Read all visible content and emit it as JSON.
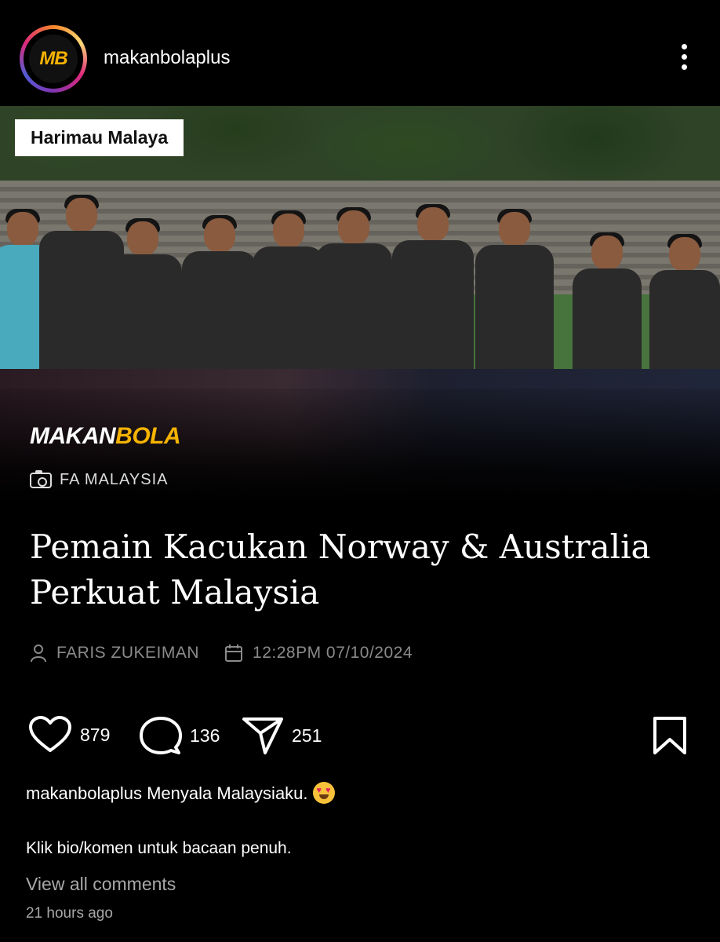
{
  "header": {
    "username": "makanbolaplus",
    "avatar_text": "MB"
  },
  "post_image": {
    "category_tag": "Harimau Malaya",
    "brand_part1": "MAKAN",
    "brand_part2": "BOLA",
    "photo_credit": "FA MALAYSIA",
    "headline": "Pemain Kacukan Norway & Australia Perkuat Malaysia",
    "author": "FARIS ZUKEIMAN",
    "datetime": "12:28PM 07/10/2024",
    "brand_colors": {
      "accent": "#f5b301"
    }
  },
  "actions": {
    "likes": "879",
    "comments": "136",
    "shares": "251"
  },
  "caption": {
    "username": "makanbolaplus",
    "text": "Menyala Malaysiaku.",
    "emoji": "smiling-face-with-heart-eyes",
    "line2": "Klik bio/komen untuk bacaan penuh."
  },
  "footer": {
    "view_comments": "View all comments",
    "time_ago": "21 hours ago"
  }
}
